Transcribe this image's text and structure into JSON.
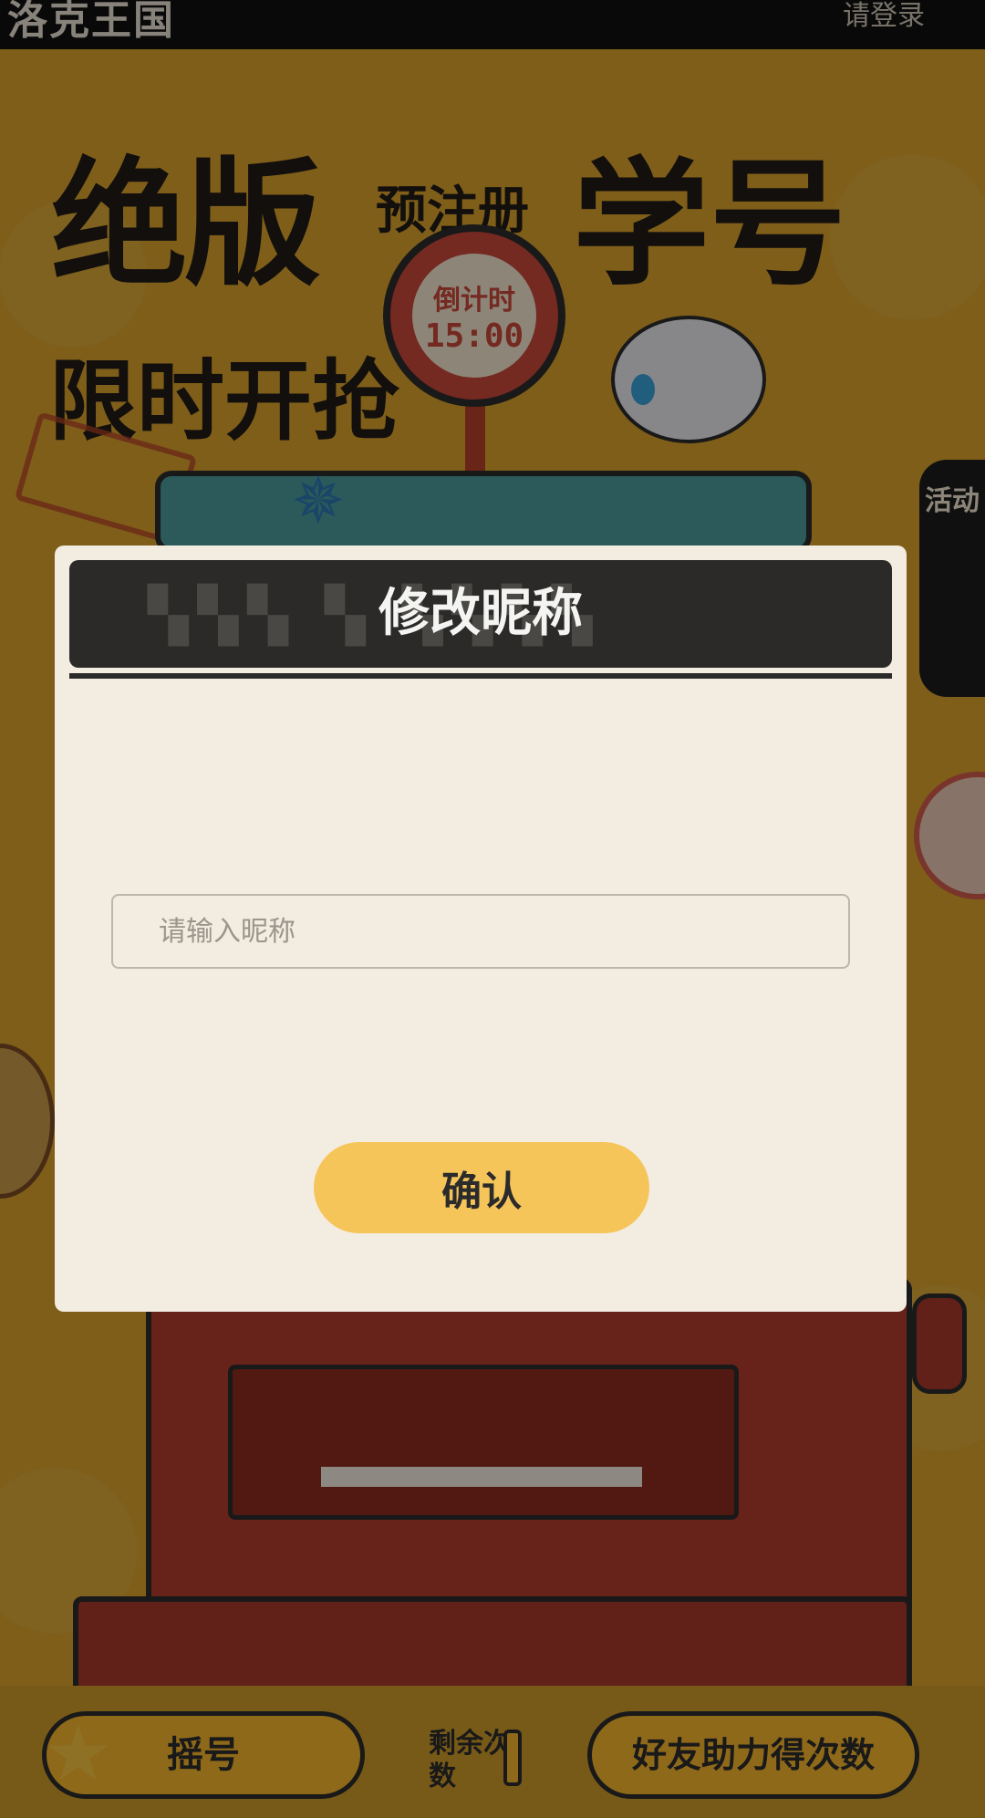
{
  "header": {
    "brand": "洛克王国",
    "login_link": "请登录"
  },
  "poster": {
    "headline_main": "绝版",
    "headline_pre": "预注册",
    "headline_right": "学号",
    "headline_limit": "限时开抢",
    "sign_title": "倒计时",
    "sign_time": "15:00",
    "activity_tab": "活动"
  },
  "modal": {
    "title": "修改昵称",
    "input_placeholder": "请输入昵称",
    "input_value": "",
    "confirm_label": "确认"
  },
  "bottom": {
    "shake_label": "摇号",
    "remain_label": "剩余次数",
    "friend_label": "好友助力得次数"
  },
  "colors": {
    "background": "#d9a22c",
    "modal_bg": "#f3ece0",
    "modal_header": "#2b2a28",
    "confirm_bg": "#f6c55a",
    "machine_red": "#b13b2d"
  }
}
